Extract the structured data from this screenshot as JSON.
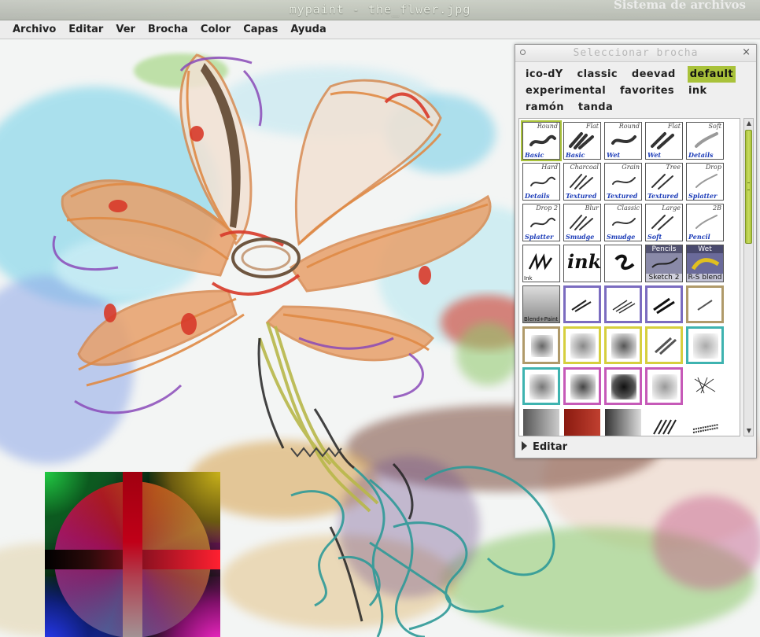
{
  "desktop": {
    "label": "Sistema de archivos"
  },
  "window": {
    "title": "mypaint - the_flwer.jpg"
  },
  "menu": [
    "Archivo",
    "Editar",
    "Ver",
    "Brocha",
    "Color",
    "Capas",
    "Ayuda"
  ],
  "brush_dialog": {
    "title": "Seleccionar brocha",
    "close_glyph": "×",
    "groups": [
      "ico-dY",
      "classic",
      "deevad",
      "default",
      "experimental",
      "favorites",
      "ink",
      "ramón",
      "tanda"
    ],
    "active_group": "default",
    "brushes": [
      {
        "top": "Round",
        "bottom": "Basic"
      },
      {
        "top": "Flat",
        "bottom": "Basic"
      },
      {
        "top": "Round",
        "bottom": "Wet"
      },
      {
        "top": "Flat",
        "bottom": "Wet"
      },
      {
        "top": "Soft",
        "bottom": "Details"
      },
      {
        "top": "Hard",
        "bottom": "Details"
      },
      {
        "top": "Charcoal",
        "bottom": "Textured"
      },
      {
        "top": "Grain",
        "bottom": "Textured"
      },
      {
        "top": "Tree",
        "bottom": "Textured"
      },
      {
        "top": "Drop",
        "bottom": "Splatter"
      },
      {
        "top": "Drop 2",
        "bottom": "Splatter"
      },
      {
        "top": "Blur",
        "bottom": "Smudge"
      },
      {
        "top": "Classic",
        "bottom": "Smudge"
      },
      {
        "top": "Large",
        "bottom": "Soft"
      },
      {
        "top": "2B",
        "bottom": "Pencil"
      }
    ],
    "extra_tiles": {
      "ink": "Ink",
      "ink_word": "ink",
      "pencils_top": "Pencils",
      "pencils_bottom": "Sketch 2",
      "wet_top": "Wet",
      "wet_bottom": "R-S blend",
      "blend": "Blend+Paint"
    },
    "edit_label": "Editar"
  },
  "colors": {
    "accent": "#a9c23a",
    "label_blue": "#1c3cb8"
  }
}
